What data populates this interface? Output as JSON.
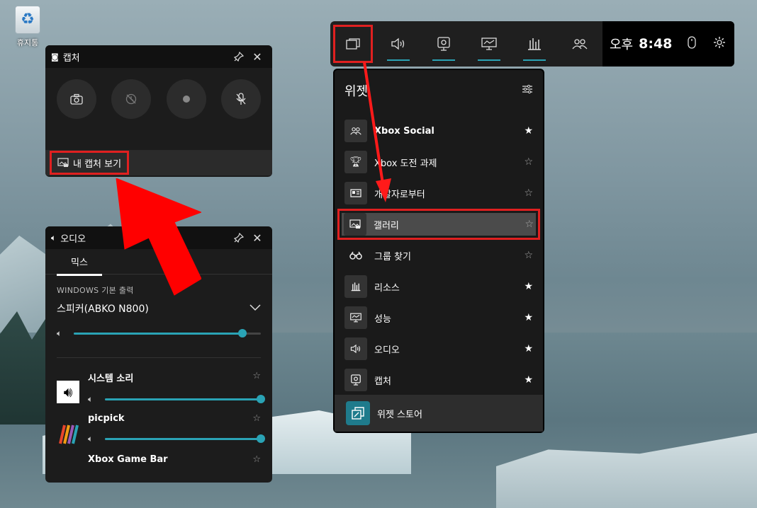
{
  "desktop": {
    "recycle_bin_label": "휴지통"
  },
  "capture": {
    "title": "캡처",
    "buttons": [
      "screenshot-icon",
      "record-last-icon",
      "record-icon",
      "mic-off-icon"
    ],
    "view_captures_label": "내 캡처 보기"
  },
  "audio": {
    "title": "오디오",
    "tab_mix": "믹스",
    "section_label": "WINDOWS 기본 출력",
    "device": "스피커(ABKO N800)",
    "master_volume": 0.9,
    "apps": [
      {
        "name": "시스템 소리",
        "volume": 1.0
      },
      {
        "name": "picpick",
        "volume": 1.0
      },
      {
        "name": "Xbox Game Bar",
        "volume": 1.0
      }
    ]
  },
  "topbar": {
    "buttons": [
      "widget-menu-icon",
      "audio-icon",
      "capture-icon",
      "performance-icon",
      "resources-icon",
      "social-icon"
    ],
    "ampm": "오후",
    "time": "8:48"
  },
  "widgets": {
    "title": "위젯",
    "items": [
      {
        "label": "Xbox Social",
        "icon": "social-icon",
        "favorite": true
      },
      {
        "label": "Xbox 도전 과제",
        "icon": "trophy-icon",
        "favorite": false
      },
      {
        "label": "개발자로부터",
        "icon": "news-icon",
        "favorite": false
      },
      {
        "label": "갤러리",
        "icon": "gallery-icon",
        "favorite": false
      },
      {
        "label": "그룹 찾기",
        "icon": "binoculars-icon",
        "favorite": false
      },
      {
        "label": "리소스",
        "icon": "resources-icon",
        "favorite": true
      },
      {
        "label": "성능",
        "icon": "performance-icon",
        "favorite": true
      },
      {
        "label": "오디오",
        "icon": "audio-icon",
        "favorite": true
      },
      {
        "label": "캡처",
        "icon": "capture-icon",
        "favorite": true
      }
    ],
    "store_label": "위젯 스토어"
  },
  "colors": {
    "accent": "#2aa3b5",
    "highlight": "#e02020",
    "panel_bg": "#1c1c1c"
  }
}
